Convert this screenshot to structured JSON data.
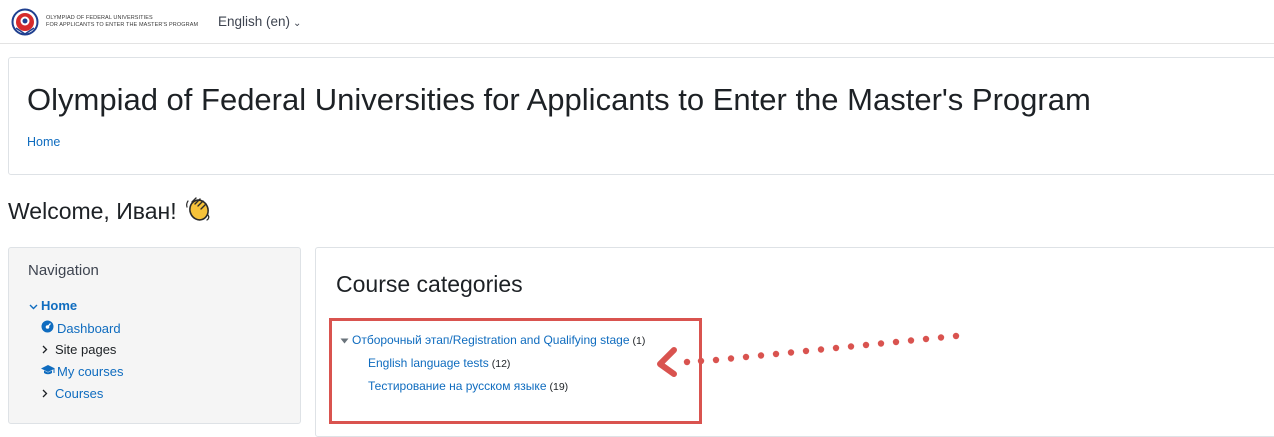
{
  "header": {
    "logo_line1": "OLYMPIAD OF FEDERAL UNIVERSITIES",
    "logo_line2": "FOR APPLICANTS TO ENTER THE MASTER'S PROGRAM",
    "language": "English (en)"
  },
  "page": {
    "title": "Olympiad of Federal Universities for Applicants to Enter the Master's Program",
    "breadcrumb": "Home",
    "welcome": "Welcome, Иван!",
    "welcome_emoji": "waving-hand-icon"
  },
  "navigation": {
    "title": "Navigation",
    "items": [
      {
        "label": "Home",
        "icon": "chevron-down-icon"
      },
      {
        "label": "Dashboard",
        "icon": "dashboard-icon"
      },
      {
        "label": "Site pages",
        "icon": "chevron-right-icon"
      },
      {
        "label": "My courses",
        "icon": "graduation-cap-icon"
      },
      {
        "label": "Courses",
        "icon": "chevron-right-icon"
      }
    ]
  },
  "course_categories": {
    "title": "Course categories",
    "categories": [
      {
        "name": "Отборочный этап/Registration and Qualifying stage",
        "count": "(1)"
      },
      {
        "name": "English language tests",
        "count": "(12)"
      },
      {
        "name": "Тестирование на русском языке",
        "count": "(19)"
      }
    ]
  },
  "colors": {
    "link": "#0f6cbf",
    "annotation": "#d9534f"
  }
}
